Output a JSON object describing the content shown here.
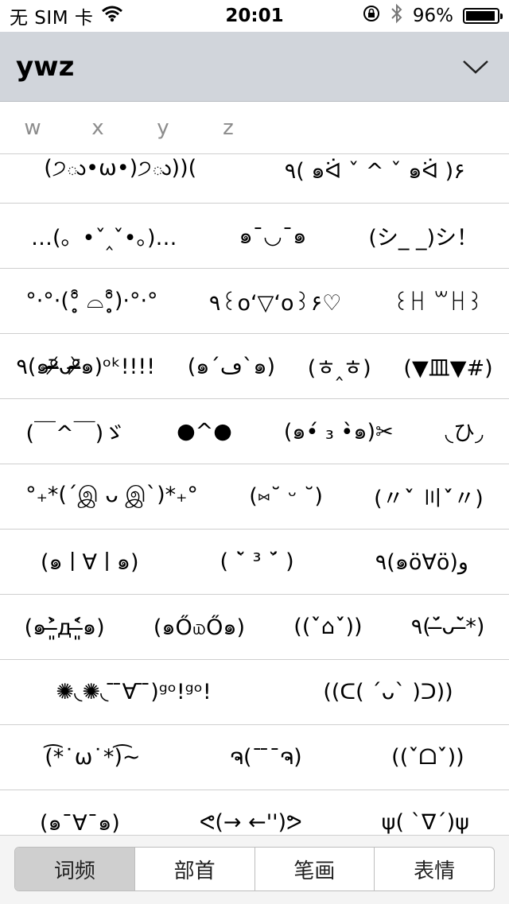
{
  "status_bar": {
    "carrier": "无 SIM 卡",
    "time": "20:01",
    "battery_percent": "96%",
    "battery_level": 0.96,
    "icons": [
      "wifi-icon",
      "rotation-lock-icon",
      "bluetooth-icon",
      "battery-icon"
    ]
  },
  "header": {
    "title": "ywz"
  },
  "letters": [
    "w",
    "x",
    "y",
    "z"
  ],
  "rows": [
    [
      "(੭ు•ω•)੭ు))(",
      "٩( ๑ᐛ ˇ ^ ˇ ๑ᐛ )۶"
    ],
    [
      "…(。•ˇ‸ˇ•。)…",
      "๑¯◡¯๑",
      "(シ_ _)シ！"
    ],
    [
      "°·°·(°̥̥̥͒ ⌓°̥̥̥͒)·°·°",
      "٩꒰o‘▽‘o꒱۶♡",
      "꒰ꀿ ꒳ꀿ꒱"
    ],
    [
      "٩(๑ᵒ̴̶̷᷄ᴗᵒ̴̶̷᷅๑)ᵒᵏ!!!!",
      "(๑´ڡ`๑)",
      "(ㅎ‸ㅎ)",
      "(▼皿▼#)"
    ],
    [
      "(￣^￣)ゞ",
      "●^●",
      "(๑•́ ₃ •̀๑)✂",
      "◟ひ◞"
    ],
    [
      "°₊*(´இ ᴗ இ`)*₊°",
      "(⑅˘ ᵕ ˘)",
      "(〃ˇ̀ 〣ˇ́〃)"
    ],
    [
      "(๑ㅣ∀ㅣ๑)",
      "( ˘̀ ³ ˘́ )",
      "٩(๑ö∀ö)و"
    ],
    [
      "(๑˃̶͈̀д˂̶͈́๑)",
      "(๑Ő௰Ő๑)",
      "((ˇ̀⌂ˇ́))",
      "٩(˘̶́ᴗ˘̶̀*)"
    ],
    [
      "✺◟✺◟ ̄ ̄∀ ̄ ̄)ᵍᵒ!ᵍᵒ!",
      "((ᑕ( ´ᴗ` )ᑐ))"
    ],
    [
      "(͡*˙ω˙*)͡~",
      "ຈ(¯ ̄¯ຈ)",
      "((ˇ̀ᗝˇ́))"
    ],
    [
      "(๑ˉ∀ˉ๑)",
      "ᕙ(→ ←'')ᕗ",
      "ψ( `∇´)ψ"
    ]
  ],
  "tabs": [
    {
      "label": "词频",
      "active": true
    },
    {
      "label": "部首",
      "active": false
    },
    {
      "label": "笔画",
      "active": false
    },
    {
      "label": "表情",
      "active": false
    }
  ]
}
